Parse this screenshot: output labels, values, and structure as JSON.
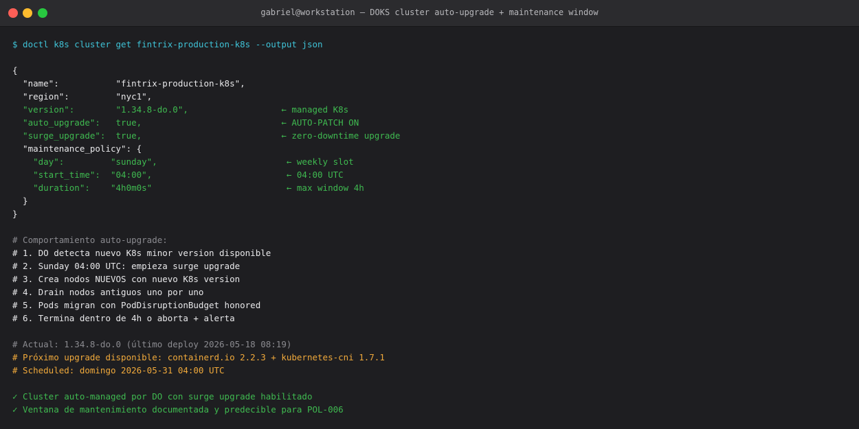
{
  "window": {
    "title": "gabriel@workstation — DOKS cluster auto-upgrade + maintenance window"
  },
  "colors": {
    "background": "#1e1e21",
    "titlebar": "#2b2b2e",
    "prompt": "#3fc2d6",
    "highlight": "#3fb950",
    "comment": "#8b8b90",
    "warning": "#f0a93b",
    "text": "#e8e8ea"
  },
  "terminal": {
    "command": "$ doctl k8s cluster get fintrix-production-k8s --output json",
    "json": {
      "open": "{",
      "name": "  \"name\":           \"fintrix-production-k8s\",",
      "region": "  \"region\":         \"nyc1\",",
      "version": "  \"version\":        \"1.34.8-do.0\",                  ← managed K8s",
      "auto_upgrade": "  \"auto_upgrade\":   true,                           ← AUTO-PATCH ON",
      "surge_upgrade": "  \"surge_upgrade\":  true,                           ← zero-downtime upgrade",
      "maintenance_open": "  \"maintenance_policy\": {",
      "day": "    \"day\":         \"sunday\",                         ← weekly slot",
      "start_time": "    \"start_time\":  \"04:00\",                          ← 04:00 UTC",
      "duration": "    \"duration\":    \"4h0m0s\"                          ← max window 4h",
      "maintenance_close": "  }",
      "close": "}"
    },
    "behavior": {
      "header": "# Comportamiento auto-upgrade:",
      "steps": [
        "# 1. DO detecta nuevo K8s minor version disponible",
        "# 2. Sunday 04:00 UTC: empieza surge upgrade",
        "# 3. Crea nodos NUEVOS con nuevo K8s version",
        "# 4. Drain nodos antiguos uno por uno",
        "# 5. Pods migran con PodDisruptionBudget honored",
        "# 6. Termina dentro de 4h o aborta + alerta"
      ]
    },
    "status": {
      "current": "# Actual: 1.34.8-do.0 (último deploy 2026-05-18 08:19)",
      "next": "# Próximo upgrade disponible: containerd.io 2.2.3 + kubernetes-cni 1.7.1",
      "scheduled": "# Scheduled: domingo 2026-05-31 04:00 UTC"
    },
    "checks": [
      "✓ Cluster auto-managed por DO con surge upgrade habilitado",
      "✓ Ventana de mantenimiento documentada y predecible para POL-006"
    ]
  }
}
